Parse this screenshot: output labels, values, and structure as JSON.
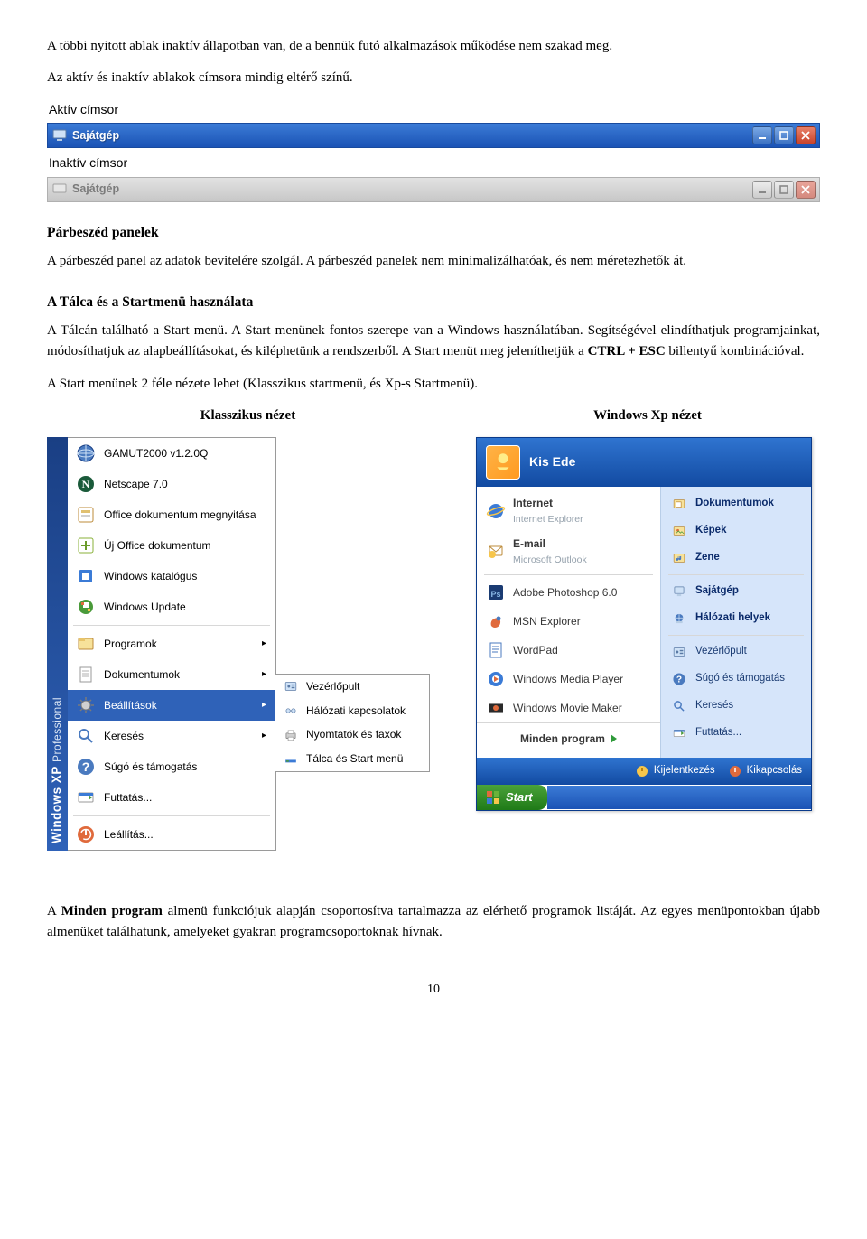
{
  "intro": {
    "p1": "A többi nyitott ablak inaktív állapotban van, de a bennük futó alkalmazások működése nem szakad meg.",
    "p2": "Az aktív és inaktív ablakok címsora mindig eltérő színű."
  },
  "titlebars": {
    "active_label": "Aktív címsor",
    "inactive_label": "Inaktív címsor",
    "title": "Sajátgép"
  },
  "dialog": {
    "heading": "Párbeszéd panelek",
    "p": "A párbeszéd panel az adatok bevitelére szolgál. A párbeszéd panelek nem minimalizálhatóak, és nem méretezhetők át."
  },
  "taskbar": {
    "heading": "A Tálca és a Startmenü használata",
    "p1": "A Tálcán található a Start menü. A Start menünek fontos szerepe van a Windows használatában. Segítségével elindíthatjuk programjainkat, módosíthatjuk az alapbeállításokat, és kiléphetünk a rendszerből. A Start menüt meg jeleníthetjük a ",
    "bold": "CTRL + ESC",
    "p1b": " billentyű kombinációval.",
    "p2": "A Start menünek 2 féle nézete lehet (Klasszikus startmenü, és Xp-s Startmenü)."
  },
  "views": {
    "classic_label": "Klasszikus nézet",
    "xp_label": "Windows Xp nézet"
  },
  "classic": {
    "sidebar_main": "Windows XP",
    "sidebar_sub": "Professional",
    "items_top": [
      {
        "label": "GAMUT2000 v1.2.0Q",
        "icon": "globe"
      },
      {
        "label": "Netscape 7.0",
        "icon": "netscape"
      },
      {
        "label": "Office dokumentum megnyitása",
        "icon": "office"
      },
      {
        "label": "Új Office dokumentum",
        "icon": "office-new"
      },
      {
        "label": "Windows katalógus",
        "icon": "catalog"
      },
      {
        "label": "Windows Update",
        "icon": "update"
      }
    ],
    "items_mid": [
      {
        "label": "Programok",
        "icon": "programs",
        "folder": true
      },
      {
        "label": "Dokumentumok",
        "icon": "documents",
        "folder": true
      },
      {
        "label": "Beállítások",
        "icon": "settings",
        "folder": true,
        "selected": true
      },
      {
        "label": "Keresés",
        "icon": "search",
        "folder": true
      },
      {
        "label": "Súgó és támogatás",
        "icon": "help"
      },
      {
        "label": "Futtatás...",
        "icon": "run"
      }
    ],
    "items_bot": [
      {
        "label": "Leállítás...",
        "icon": "shutdown"
      }
    ],
    "submenu": [
      {
        "label": "Vezérlőpult",
        "icon": "cpl"
      },
      {
        "label": "Hálózati kapcsolatok",
        "icon": "net"
      },
      {
        "label": "Nyomtatók és faxok",
        "icon": "printer"
      },
      {
        "label": "Tálca és Start menü",
        "icon": "taskbar"
      }
    ]
  },
  "xp": {
    "user": "Kis Ede",
    "left_pinned": [
      {
        "main": "Internet",
        "sub": "Internet Explorer",
        "icon": "ie"
      },
      {
        "main": "E-mail",
        "sub": "Microsoft Outlook",
        "icon": "outlook"
      }
    ],
    "left_recent": [
      {
        "main": "Adobe Photoshop 6.0",
        "icon": "ps"
      },
      {
        "main": "MSN Explorer",
        "icon": "msn"
      },
      {
        "main": "WordPad",
        "icon": "wordpad"
      },
      {
        "main": "Windows Media Player",
        "icon": "wmp"
      },
      {
        "main": "Windows Movie Maker",
        "icon": "wmm"
      }
    ],
    "all_programs": "Minden program",
    "right_top": [
      {
        "main": "Dokumentumok",
        "icon": "mydocs"
      },
      {
        "main": "Képek",
        "icon": "mypics"
      },
      {
        "main": "Zene",
        "icon": "mymusic"
      }
    ],
    "right_mid": [
      {
        "main": "Sajátgép",
        "icon": "mycomp"
      },
      {
        "main": "Hálózati helyek",
        "icon": "netplaces"
      }
    ],
    "right_bot": [
      {
        "main": "Vezérlőpult",
        "icon": "cpl"
      },
      {
        "main": "Súgó és támogatás",
        "icon": "help"
      },
      {
        "main": "Keresés",
        "icon": "search"
      },
      {
        "main": "Futtatás...",
        "icon": "run"
      }
    ],
    "footer": {
      "logoff": "Kijelentkezés",
      "shutdown": "Kikapcsolás"
    },
    "start": "Start"
  },
  "closing": {
    "p": "A ",
    "bold": "Minden program",
    "p2": " almenü funkciójuk alapján csoportosítva tartalmazza az elérhető programok listáját. Az egyes menüpontokban újabb almenüket találhatunk, amelyeket gyakran programcsoportoknak hívnak."
  },
  "page": "10"
}
